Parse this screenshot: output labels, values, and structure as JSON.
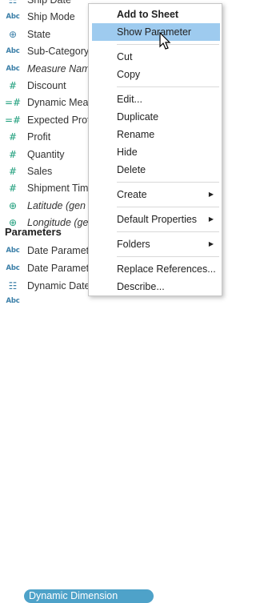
{
  "fields": [
    {
      "icon": "calendar-icon",
      "glyph": "☷",
      "label": "Ship Date",
      "italic": false,
      "type": "dim"
    },
    {
      "icon": "abc-icon",
      "glyph": "Abc",
      "label": "Ship Mode",
      "italic": false,
      "type": "abc"
    },
    {
      "icon": "globe-icon",
      "glyph": "⊕",
      "label": "State",
      "italic": false,
      "type": "dim"
    },
    {
      "icon": "abc-icon",
      "glyph": "Abc",
      "label": "Sub-Category",
      "italic": false,
      "type": "abc"
    },
    {
      "icon": "abc-icon",
      "glyph": "Abc",
      "label": "Measure Nam",
      "italic": true,
      "type": "abc"
    },
    {
      "icon": "hash-icon",
      "glyph": "#",
      "label": "Discount",
      "italic": false,
      "type": "measure"
    },
    {
      "icon": "calc-hash-icon",
      "glyph": "=#",
      "label": "Dynamic Mea",
      "italic": false,
      "type": "measure"
    },
    {
      "icon": "calc-hash-icon",
      "glyph": "=#",
      "label": "Expected Prof",
      "italic": false,
      "type": "measure"
    },
    {
      "icon": "hash-icon",
      "glyph": "#",
      "label": "Profit",
      "italic": false,
      "type": "measure"
    },
    {
      "icon": "hash-icon",
      "glyph": "#",
      "label": "Quantity",
      "italic": false,
      "type": "measure"
    },
    {
      "icon": "hash-icon",
      "glyph": "#",
      "label": "Sales",
      "italic": false,
      "type": "measure"
    },
    {
      "icon": "hash-icon",
      "glyph": "#",
      "label": "Shipment Tim",
      "italic": false,
      "type": "measure"
    },
    {
      "icon": "globe-icon",
      "glyph": "⊕",
      "label": "Latitude (gen",
      "italic": true,
      "type": "measure"
    },
    {
      "icon": "globe-icon",
      "glyph": "⊕",
      "label": "Longitude (ge",
      "italic": true,
      "type": "measure"
    }
  ],
  "parameters_heading": "Parameters",
  "parameters": [
    {
      "icon": "abc-icon",
      "glyph": "Abc",
      "label": "Date Paramet",
      "type": "abc"
    },
    {
      "icon": "abc-icon",
      "glyph": "Abc",
      "label": "Date Paramet",
      "type": "abc"
    },
    {
      "icon": "calendar-icon",
      "glyph": "☷",
      "label": "Dynamic Date",
      "type": "dim"
    }
  ],
  "selected_parameter": {
    "icon": "abc-icon",
    "glyph": "Abc",
    "label": "Dynamic Dimension"
  },
  "context_menu": [
    {
      "label": "Add to Sheet",
      "bold": true
    },
    {
      "label": "Show Parameter",
      "highlighted": true
    },
    {
      "separator": true
    },
    {
      "label": "Cut"
    },
    {
      "label": "Copy"
    },
    {
      "separator": true
    },
    {
      "label": "Edit..."
    },
    {
      "label": "Duplicate"
    },
    {
      "label": "Rename"
    },
    {
      "label": "Hide"
    },
    {
      "label": "Delete"
    },
    {
      "separator": true
    },
    {
      "label": "Create",
      "submenu": true
    },
    {
      "separator": true
    },
    {
      "label": "Default Properties",
      "submenu": true
    },
    {
      "separator": true
    },
    {
      "label": "Folders",
      "submenu": true
    },
    {
      "separator": true
    },
    {
      "label": "Replace References..."
    },
    {
      "label": "Describe..."
    }
  ]
}
